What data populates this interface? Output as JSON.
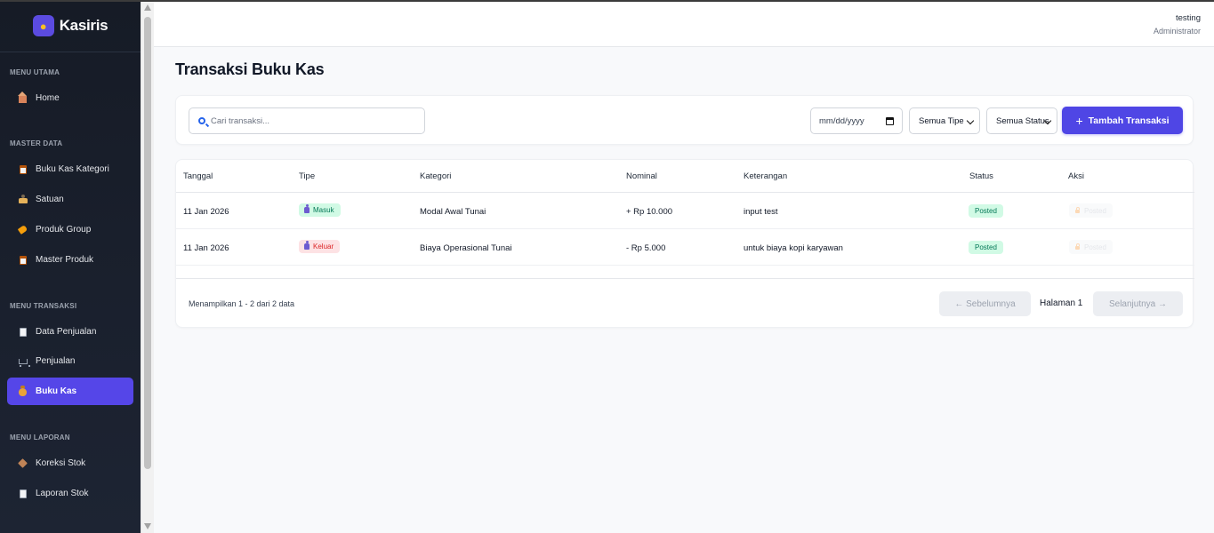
{
  "app": {
    "name": "Kasiris",
    "logo_icon": "money-bag-icon"
  },
  "sidebar": {
    "sections": [
      {
        "title": "MENU UTAMA",
        "items": [
          {
            "label": "Home",
            "icon": "home-icon"
          }
        ]
      },
      {
        "title": "MASTER DATA",
        "items": [
          {
            "label": "Buku Kas Kategori",
            "icon": "clipboard-icon"
          },
          {
            "label": "Satuan",
            "icon": "scale-icon"
          },
          {
            "label": "Produk Group",
            "icon": "tag-icon"
          },
          {
            "label": "Master Produk",
            "icon": "clipboard-icon"
          }
        ]
      },
      {
        "title": "MENU TRANSAKSI",
        "items": [
          {
            "label": "Data Penjualan",
            "icon": "document-icon"
          },
          {
            "label": "Penjualan",
            "icon": "cart-icon"
          },
          {
            "label": "Buku Kas",
            "icon": "money-bag-icon",
            "active": true
          }
        ]
      },
      {
        "title": "MENU LAPORAN",
        "items": [
          {
            "label": "Koreksi Stok",
            "icon": "box-icon"
          },
          {
            "label": "Laporan Stok",
            "icon": "document-icon"
          }
        ]
      }
    ],
    "active_color": "#5546e8"
  },
  "header": {
    "user_name": "testing",
    "user_role": "Administrator"
  },
  "page": {
    "title": "Transaksi Buku Kas"
  },
  "filters": {
    "search_placeholder": "Cari transaksi...",
    "date_placeholder": "mm/dd/yyyy",
    "type_select": "Semua Tipe",
    "status_select": "Semua Status",
    "add_button": "Tambah Transaksi",
    "accent_color": "#4f46e5"
  },
  "table": {
    "columns": [
      "Tanggal",
      "Tipe",
      "Kategori",
      "Nominal",
      "Keterangan",
      "Status",
      "Aksi"
    ],
    "rows": [
      {
        "tanggal": "11 Jan 2026",
        "tipe": "Masuk",
        "kategori": "Modal Awal Tunai",
        "nominal": "+ Rp 10.000",
        "keterangan": "input test",
        "status": "Posted",
        "aksi": "Posted"
      },
      {
        "tanggal": "11 Jan 2026",
        "tipe": "Keluar",
        "kategori": "Biaya Operasional Tunai",
        "nominal": "- Rp 5.000",
        "keterangan": "untuk biaya kopi karyawan",
        "status": "Posted",
        "aksi": "Posted"
      }
    ]
  },
  "pagination": {
    "info": "Menampilkan 1 - 2 dari 2 data",
    "prev": "← Sebelumnya",
    "page": "Halaman 1",
    "next": "Selanjutnya →"
  }
}
